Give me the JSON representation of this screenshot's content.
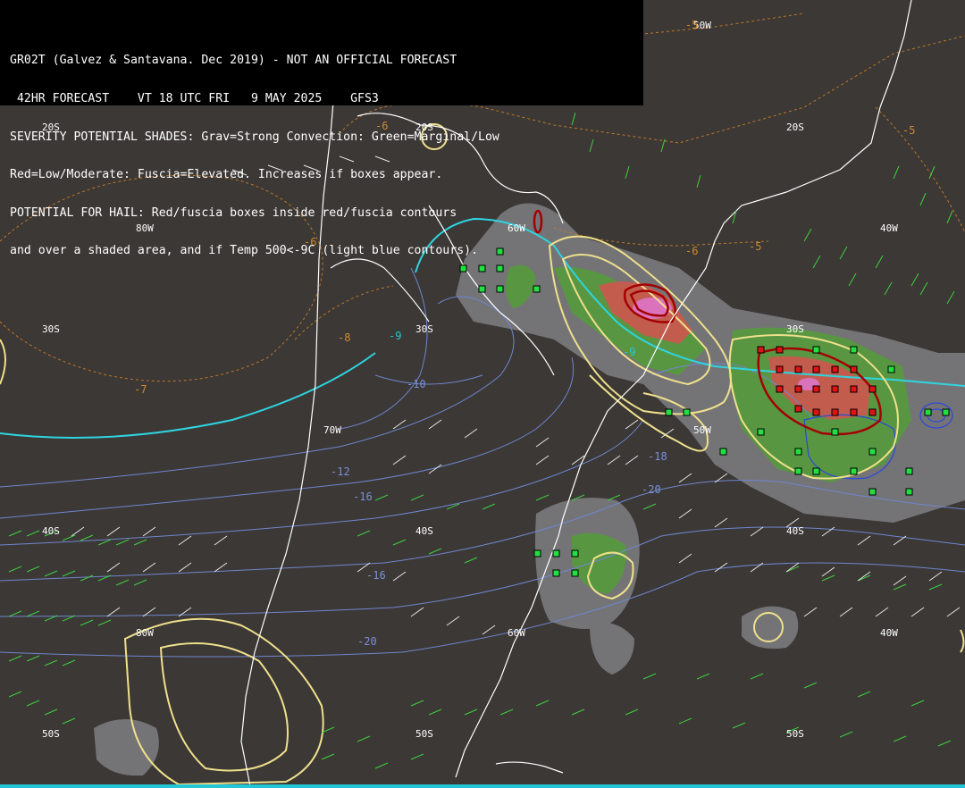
{
  "header": {
    "lines": [
      "GR02T (Galvez & Santavana. Dec 2019) - NOT AN OFFICIAL FORECAST",
      " 42HR FORECAST    VT 18 UTC FRI   9 MAY 2025    GFS3",
      "SEVERITY POTENTIAL SHADES: Grav=Strong Convection: Green=Marginal/Low",
      "Red=Low/Moderate: Fuscia=Elevated. Increases if boxes appear.",
      "POTENTIAL FOR HAIL: Red/fuscia boxes inside red/fuscia contours",
      "and over a shaded area, and if Temp 500<-9C (light blue contours)."
    ]
  },
  "grid_labels": {
    "lat_20s": "20S",
    "lat_30s": "30S",
    "lat_40s": "40S",
    "lat_50s": "50S",
    "lon_80w": "80W",
    "lon_70w": "70W",
    "lon_60w": "60W",
    "lon_50w": "50W",
    "lon_40w": "40W"
  },
  "contour_labels": {
    "orange": [
      "-5",
      "-6",
      "-6",
      "-6",
      "-5",
      "-5",
      "-7",
      "-8"
    ],
    "cyan": [
      "-9",
      "-9"
    ],
    "blue": [
      "-10",
      "-12",
      "-16",
      "-18",
      "-20",
      "-16",
      "-20"
    ]
  },
  "colors": {
    "background": "#3b3835",
    "header_bg": "#000000",
    "coastline": "#ffffff",
    "temp_500_contour": "#2fd4e0",
    "severity_gray": "#8a8a8a",
    "severity_green": "#5fa040",
    "severity_red": "#d05050",
    "severity_fuscia": "#e070d0",
    "hail_box_red": "#e01010",
    "box_green": "#20e040",
    "wind_barbs": "#40d040",
    "yellow_contour": "#f0e080",
    "red_contour": "#b00000"
  }
}
